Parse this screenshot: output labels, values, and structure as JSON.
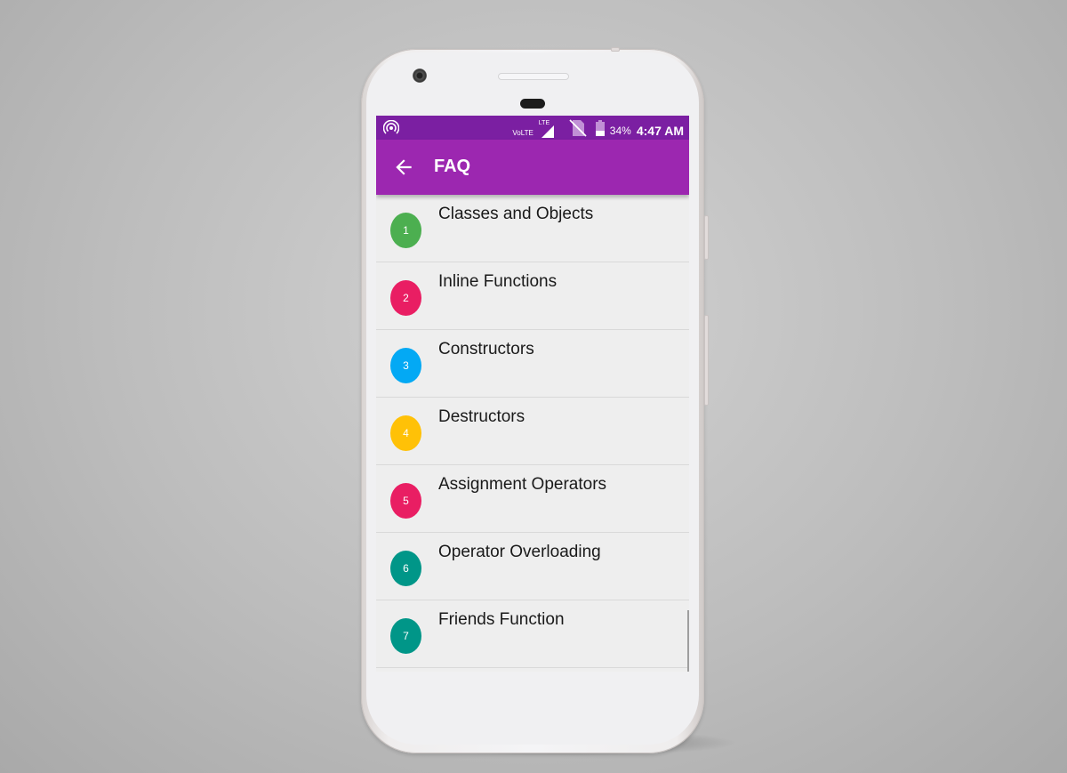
{
  "status_bar": {
    "left_icon": "hotspot-icon",
    "network_label": "VoLTE",
    "signal_label": "LTE",
    "sim_icon": "no-sim-icon",
    "battery_icon": "battery-icon",
    "battery_percent": "34%",
    "battery_level": 0.34,
    "time": "4:47 AM"
  },
  "app_bar": {
    "back_icon": "arrow-back-icon",
    "title": "FAQ",
    "color": "#9c27b0",
    "status_color": "#7b1fa2"
  },
  "list": {
    "items": [
      {
        "number": "1",
        "label": "Classes and Objects",
        "color": "#4caf50"
      },
      {
        "number": "2",
        "label": "Inline Functions",
        "color": "#e91e63"
      },
      {
        "number": "3",
        "label": "Constructors",
        "color": "#03a9f4"
      },
      {
        "number": "4",
        "label": "Destructors",
        "color": "#ffc107"
      },
      {
        "number": "5",
        "label": "Assignment Operators",
        "color": "#e91e63"
      },
      {
        "number": "6",
        "label": "Operator Overloading",
        "color": "#009688"
      },
      {
        "number": "7",
        "label": "Friends Function",
        "color": "#009688"
      }
    ]
  }
}
